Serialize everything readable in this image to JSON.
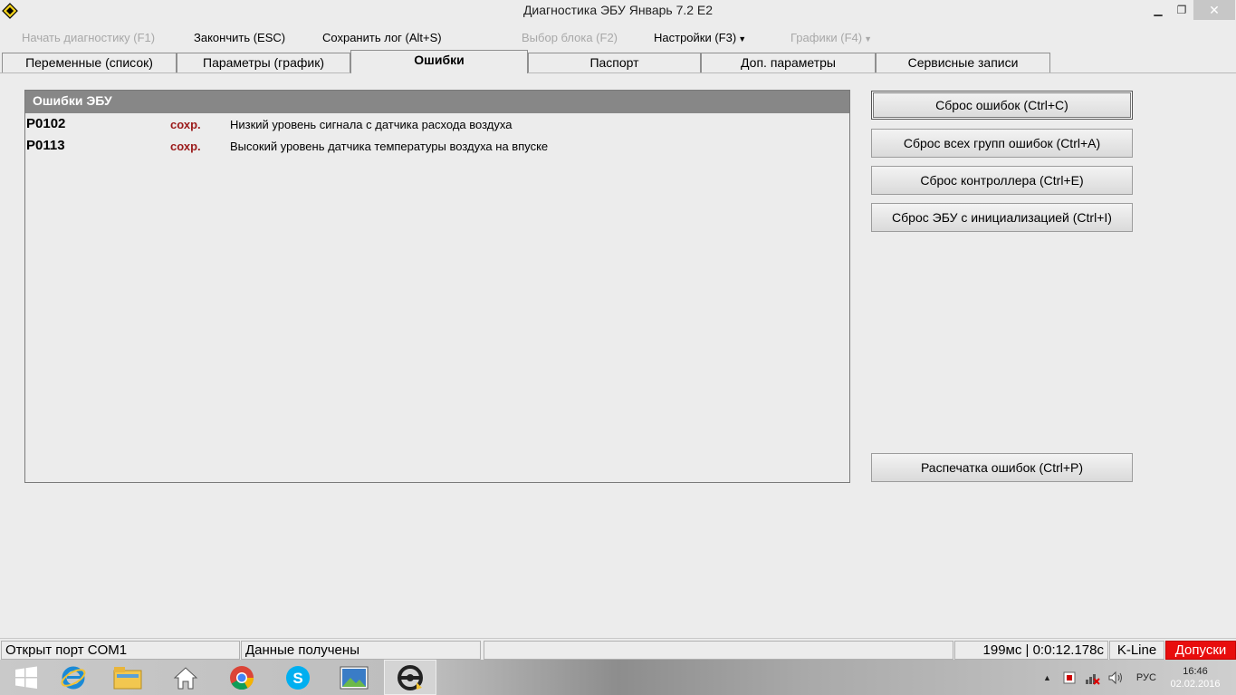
{
  "window": {
    "title": "Диагностика ЭБУ Январь 7.2 E2",
    "minimize": "▁",
    "maximize": "❐",
    "close": "✕"
  },
  "toolbar": {
    "start": "Начать диагностику (F1)",
    "finish": "Закончить (ESC)",
    "save_log": "Сохранить лог (Alt+S)",
    "select_block": "Выбор блока (F2)",
    "settings": "Настройки (F3)",
    "graphs": "Графики (F4)"
  },
  "tabs": [
    {
      "label": "Переменные (список)"
    },
    {
      "label": "Параметры (график)"
    },
    {
      "label": "Ошибки"
    },
    {
      "label": "Паспорт"
    },
    {
      "label": "Доп. параметры"
    },
    {
      "label": "Сервисные записи"
    }
  ],
  "errors_panel": {
    "title": "Ошибки ЭБУ",
    "rows": [
      {
        "code": "P0102",
        "status": "сохр.",
        "description": "Низкий уровень сигнала с датчика расхода воздуха"
      },
      {
        "code": "P0113",
        "status": "сохр.",
        "description": "Высокий уровень датчика температуры воздуха на впуске"
      }
    ]
  },
  "buttons": {
    "reset_errors": "Сброс ошибок (Ctrl+C)",
    "reset_all_groups": "Сброс всех групп ошибок (Ctrl+A)",
    "reset_controller": "Сброс контроллера (Ctrl+E)",
    "reset_ecu_init": "Сброс ЭБУ с инициализацией (Ctrl+I)",
    "print_errors": "Распечатка ошибок (Ctrl+P)"
  },
  "statusbar": {
    "port": "Открыт порт COM1",
    "data": "Данные получены",
    "empty": "",
    "timing": "199мс | 0:0:12.178с",
    "line": "K-Line",
    "alert": "Допуски"
  },
  "taskbar": {
    "lang": "РУС",
    "time": "16:46",
    "date": "02.02.2016"
  },
  "colors": {
    "panel_header": "#878787",
    "status_text": "#9b1a1a",
    "alert_bg": "#e80d0d"
  }
}
